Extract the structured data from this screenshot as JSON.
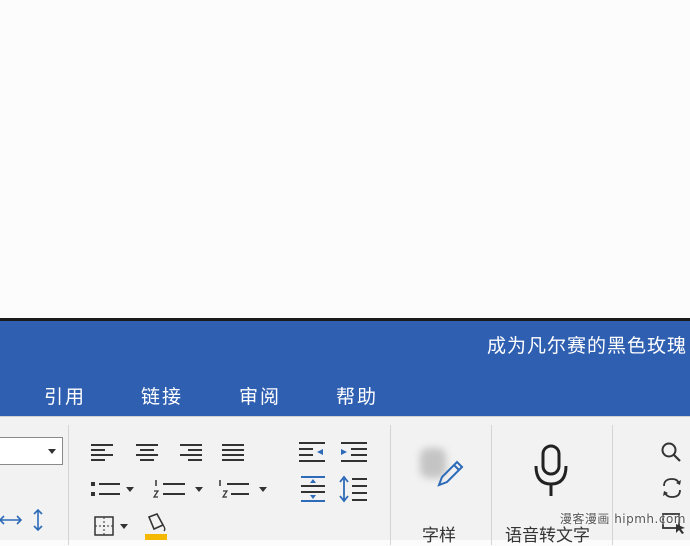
{
  "document_title": "成为凡尔赛的黑色玫瑰",
  "tabs": [
    {
      "label": "引用"
    },
    {
      "label": "链接"
    },
    {
      "label": "审阅"
    },
    {
      "label": "帮助"
    }
  ],
  "buttons": {
    "font_style_label": "字样",
    "speech_to_text_label": "语音转文字"
  },
  "watermark": "漫客漫画 hipmh.com",
  "colors": {
    "ribbon_blue": "#2f5fb1",
    "ribbon_body": "#f2f2f2",
    "accent_blue": "#2d6ab8",
    "highlight_yellow": "#f5b800"
  }
}
